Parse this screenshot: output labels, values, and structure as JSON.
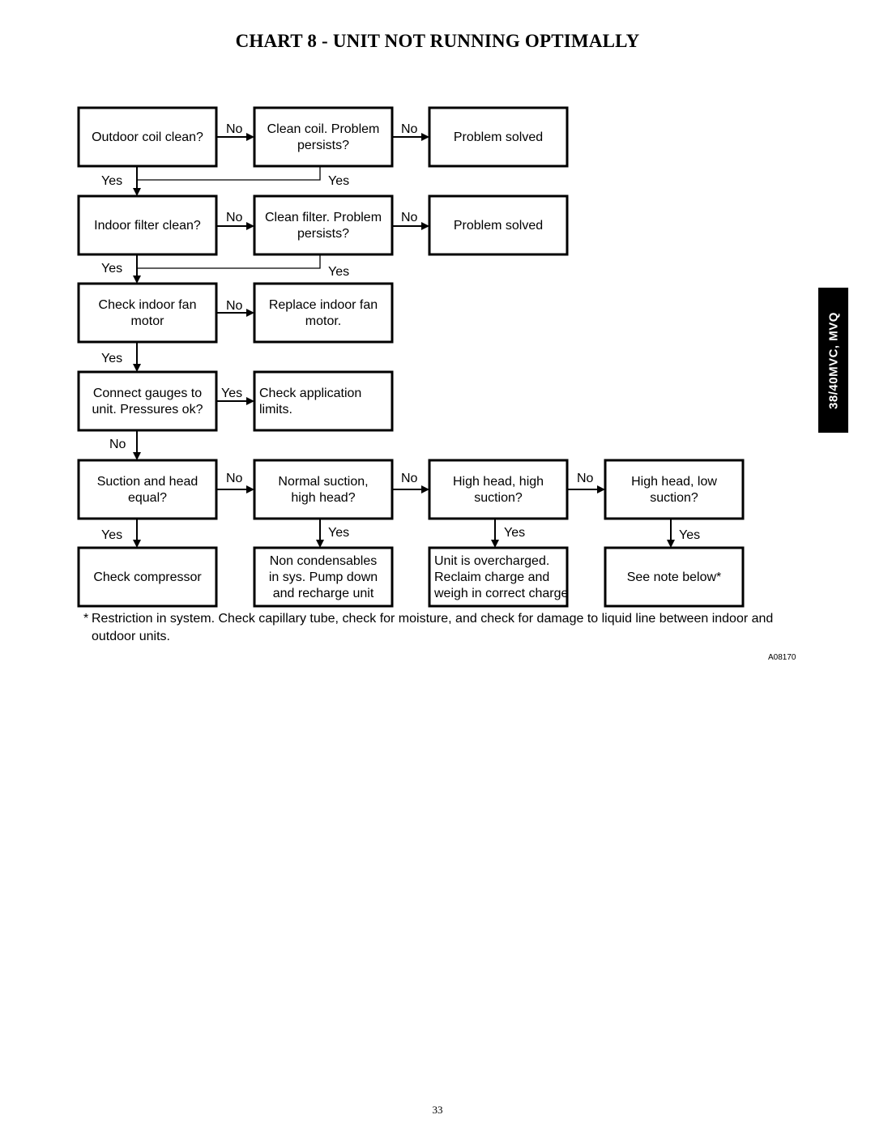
{
  "title": "CHART 8 - UNIT NOT RUNNING OPTIMALLY",
  "side_tab": "38/40MVC, MVQ",
  "nodes": {
    "outdoor_coil": [
      "Outdoor coil clean?"
    ],
    "clean_coil": [
      "Clean coil. Problem",
      "persists?"
    ],
    "solved_1": [
      "Problem solved"
    ],
    "indoor_filter": [
      "Indoor filter clean?"
    ],
    "clean_filter": [
      "Clean filter. Problem",
      "persists?"
    ],
    "solved_2": [
      "Problem solved"
    ],
    "check_fan": [
      "Check indoor fan",
      "motor"
    ],
    "replace_fan": [
      "Replace indoor fan",
      "motor."
    ],
    "gauges": [
      "Connect  gauges to",
      "unit. Pressures ok?"
    ],
    "app_limits": [
      "Check application",
      "limits."
    ],
    "suction_head_equal": [
      "Suction and head",
      "equal?"
    ],
    "normal_suction": [
      "Normal suction,",
      "high head?"
    ],
    "high_high": [
      "High head, high",
      "suction?"
    ],
    "high_low": [
      "High head, low",
      "suction?"
    ],
    "check_compressor": [
      "Check compressor"
    ],
    "non_condensables": [
      "Non condensables",
      "in sys. Pump down",
      "and recharge unit"
    ],
    "overcharged": [
      "Unit is overcharged.",
      "Reclaim charge and",
      "weigh in correct charge"
    ],
    "see_note": [
      "See note below*"
    ]
  },
  "labels": {
    "no": "No",
    "yes": "Yes"
  },
  "note": {
    "star": "*",
    "text": "Restriction in system. Check capillary tube, check for moisture, and check for damage to liquid line between indoor and outdoor units."
  },
  "figure_id": "A08170",
  "page_number": "33"
}
